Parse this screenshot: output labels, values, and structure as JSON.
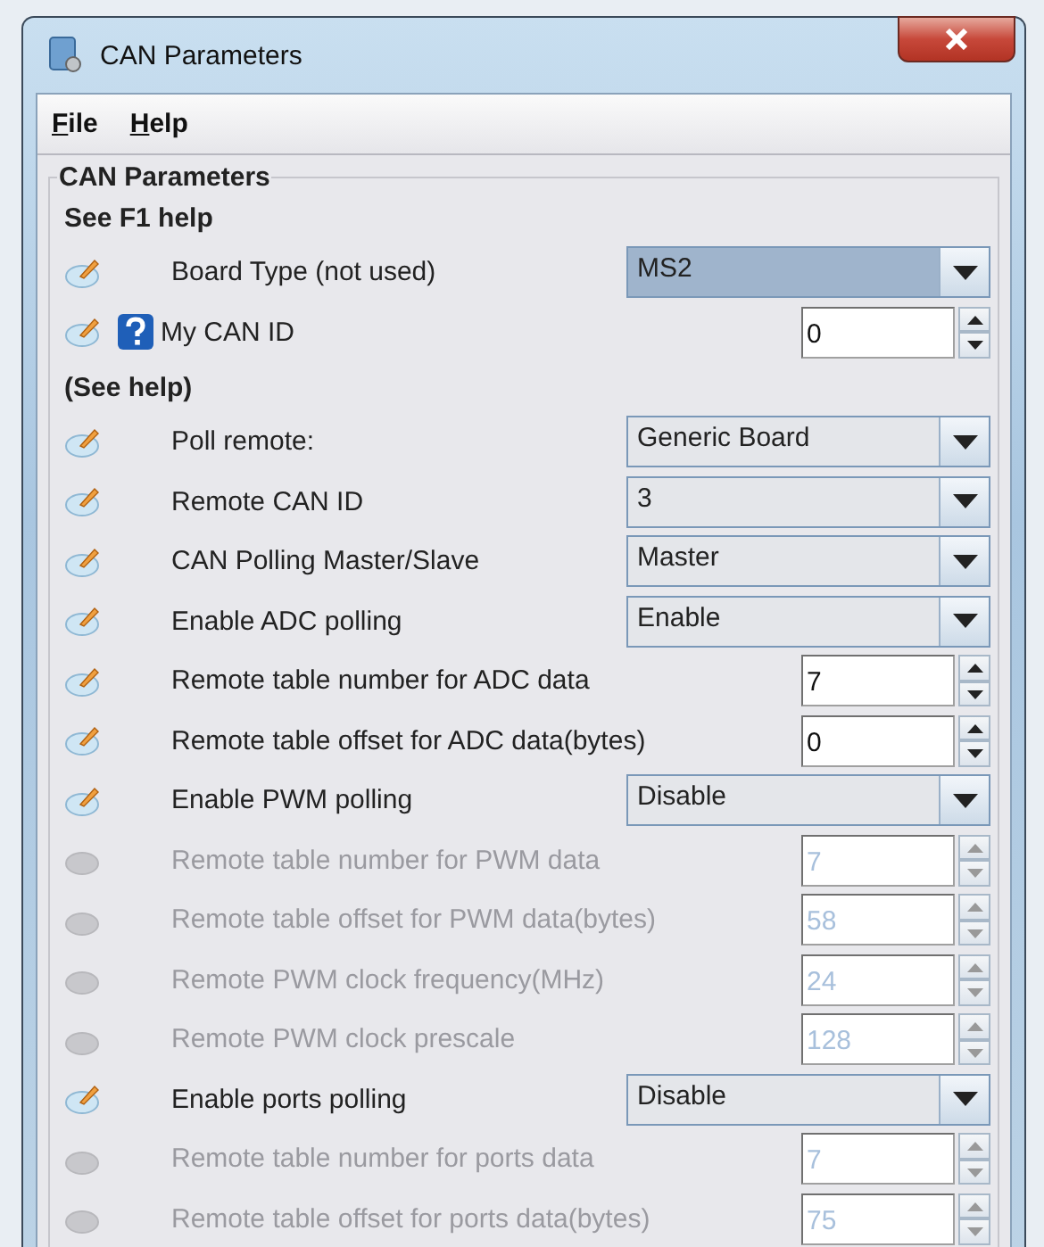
{
  "window": {
    "title": "CAN Parameters"
  },
  "menu": [
    {
      "label": "File"
    },
    {
      "label": "Help"
    }
  ],
  "group": {
    "title": "CAN Parameters",
    "items": [
      {
        "kind": "heading",
        "text": "See F1 help"
      },
      {
        "kind": "combo",
        "label": "Board Type (not used)",
        "value": "MS2",
        "disabled": false,
        "focused": true,
        "help": false
      },
      {
        "kind": "spinner",
        "label": "My CAN ID",
        "value": "0",
        "disabled": false,
        "help": true
      },
      {
        "kind": "heading",
        "text": "(See help)"
      },
      {
        "kind": "combo",
        "label": "Poll remote:",
        "value": "Generic Board",
        "disabled": false,
        "focused": false,
        "help": false
      },
      {
        "kind": "combo",
        "label": "Remote CAN ID",
        "value": "3",
        "disabled": false,
        "focused": false,
        "help": false
      },
      {
        "kind": "combo",
        "label": "CAN Polling Master/Slave",
        "value": "Master",
        "disabled": false,
        "focused": false,
        "help": false
      },
      {
        "kind": "combo",
        "label": "Enable ADC polling",
        "value": "Enable",
        "disabled": false,
        "focused": false,
        "help": false
      },
      {
        "kind": "spinner",
        "label": "Remote table number for ADC data",
        "value": "7",
        "disabled": false,
        "help": false
      },
      {
        "kind": "spinner",
        "label": "Remote table offset for ADC data(bytes)",
        "value": "0",
        "disabled": false,
        "help": false
      },
      {
        "kind": "combo",
        "label": "Enable PWM polling",
        "value": "Disable",
        "disabled": false,
        "focused": false,
        "help": false
      },
      {
        "kind": "spinner",
        "label": "Remote table number for PWM data",
        "value": "7",
        "disabled": true,
        "help": false
      },
      {
        "kind": "spinner",
        "label": "Remote table offset for PWM data(bytes)",
        "value": "58",
        "disabled": true,
        "help": false
      },
      {
        "kind": "spinner",
        "label": "Remote PWM clock frequency(MHz)",
        "value": "24",
        "disabled": true,
        "help": false
      },
      {
        "kind": "spinner",
        "label": "Remote PWM clock prescale",
        "value": "128",
        "disabled": true,
        "help": false
      },
      {
        "kind": "combo",
        "label": "Enable ports polling",
        "value": "Disable",
        "disabled": false,
        "focused": false,
        "help": false
      },
      {
        "kind": "spinner",
        "label": "Remote table number for ports data",
        "value": "7",
        "disabled": true,
        "help": false
      },
      {
        "kind": "spinner",
        "label": "Remote table offset for ports data(bytes)",
        "value": "75",
        "disabled": true,
        "help": false
      }
    ]
  }
}
